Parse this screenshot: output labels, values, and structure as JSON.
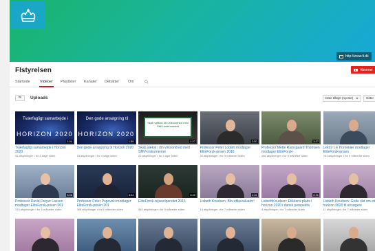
{
  "channel": {
    "name": "FIstyrelsen",
    "subscribe_label": "Abonner",
    "banner_link": "http://www.fi.dk"
  },
  "tabs": [
    "Startside",
    "Videoer",
    "Playlister",
    "Kanaler",
    "Debatter",
    "Om"
  ],
  "active_tab": "Videoer",
  "uploads": {
    "label": "Uploads",
    "sort_label": "Dato tilføjet (nyeste)",
    "grid_label": "Gitter"
  },
  "videos": [
    {
      "title": "Tværfagligt samarbejde i Horizon 2020",
      "meta": "52 afspilninger • for 4 dage siden",
      "duration": "1:01"
    },
    {
      "title": "Den gode ansøgning til Horizon 2020",
      "meta": "63 afspilninger • for 4 dage siden",
      "duration": "1:56"
    },
    {
      "title": "Skab vækst i din virksomhed med SMV-instrumentet",
      "meta": "22 afspilninger • for 3 uger siden",
      "duration": "1:27"
    },
    {
      "title": "Professor Peter Lodahl modtager EliteForsk-prisen 2016",
      "meta": "50 afspilninger • for 5 måneder siden",
      "duration": "2:30"
    },
    {
      "title": "Professor Mette Ramsgaard Thomsen modtager EliteForsk-",
      "meta": "266 afspilninger • for 5 måneder siden",
      "duration": "3:37"
    },
    {
      "title": "Lektor Liv Hornekær modtager EliteForsk-prisen",
      "meta": "261 afspilninger • for 5 måneder siden",
      "duration": ""
    },
    {
      "title": "Professor David Dreyer Lassen modtager EliteForsk-prisen 201",
      "meta": "374 afspilninger • for 5 måneder siden",
      "duration": "3:08"
    },
    {
      "title": "Professor Peter Popovski modtager EliteForsk-prisen 201",
      "meta": "388 afspilninger • for 5 måneder siden",
      "duration": "3:24"
    },
    {
      "title": "EliteForsk-rejsestipendiet 2016",
      "meta": "540 afspilninger • for 5 måneder siden",
      "duration": "0:49"
    },
    {
      "title": "Lisbeth Knudsen: Bliv etikevaluator!",
      "meta": "14 afspilninger • for 7 måneder siden",
      "duration": "1:16"
    },
    {
      "title": "LisbethKnudsen: Etikkens plads i horizon 2020 i dansk perspektiv",
      "meta": "4 afspilninger • for 7 måneder siden",
      "duration": "2:31"
    },
    {
      "title": "Lisbeth Knudsen: Gode råd om etik i horizon 2020 til ansøgere",
      "meta": "11 afspilninger • for 7 måneder siden",
      "duration": ""
    },
    {
      "title": "",
      "meta": "",
      "duration": ""
    },
    {
      "title": "",
      "meta": "",
      "duration": ""
    },
    {
      "title": "",
      "meta": "",
      "duration": ""
    },
    {
      "title": "",
      "meta": "",
      "duration": ""
    },
    {
      "title": "",
      "meta": "",
      "duration": ""
    },
    {
      "title": "",
      "meta": "",
      "duration": ""
    }
  ],
  "thumb_text": {
    "h1_line": "Tværfagligt samarbejde i",
    "h2_line": "Den gode ansøgning til",
    "horizon_word": "HORIZON 2020",
    "board_text": "Skab vækst i din virksomhed med SMV-instrumentet"
  }
}
